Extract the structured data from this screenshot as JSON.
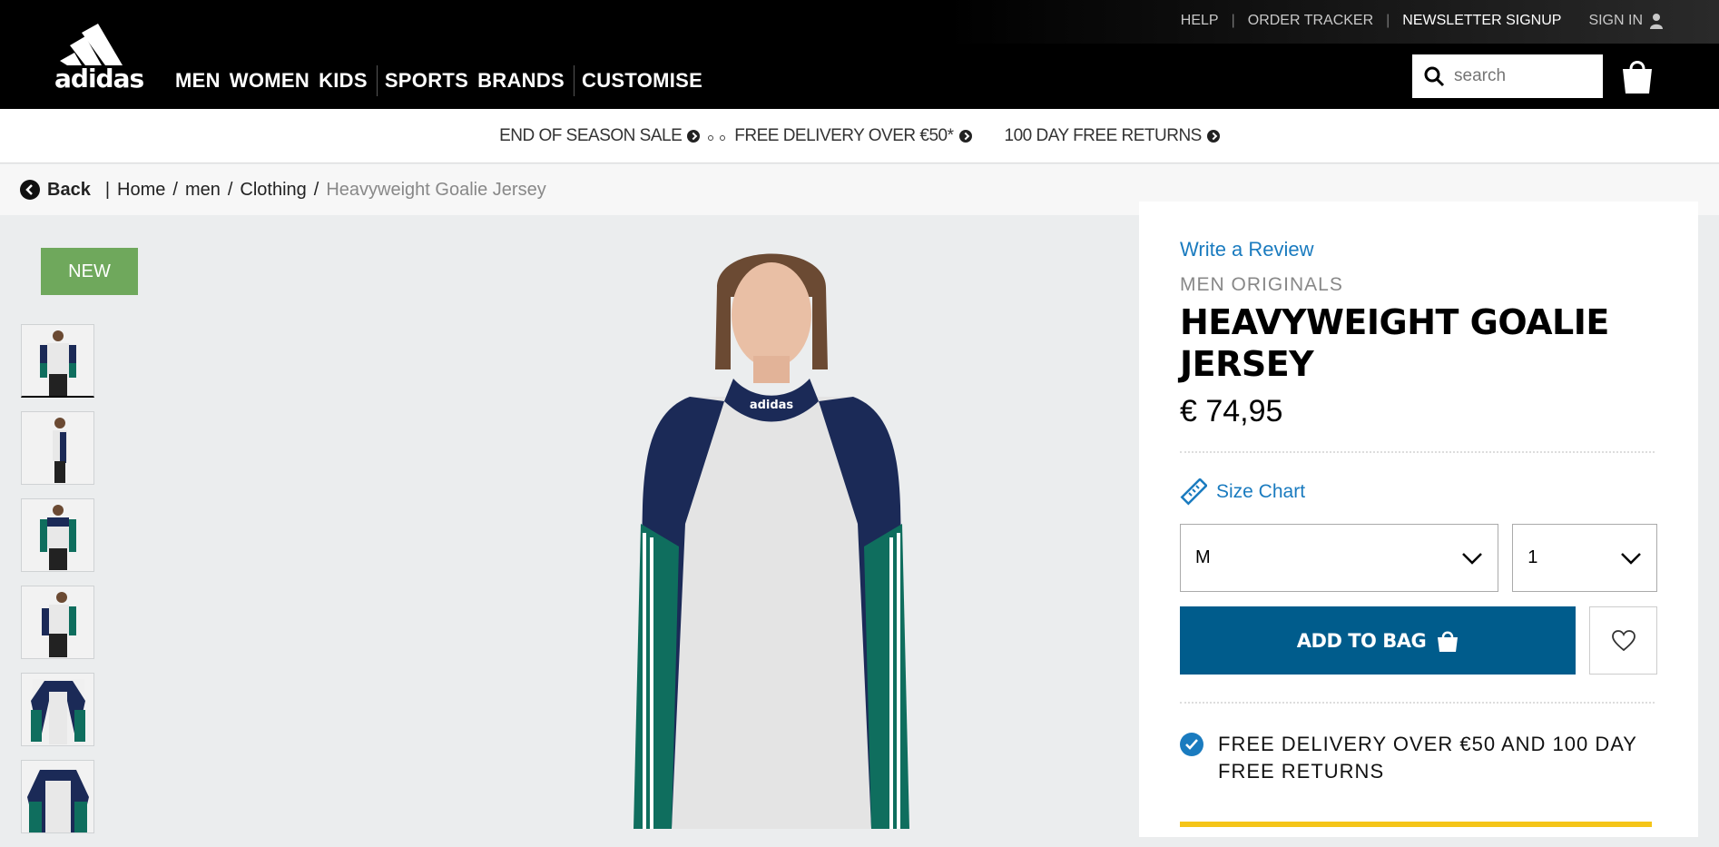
{
  "utility_nav": {
    "help": "HELP",
    "order_tracker": "ORDER TRACKER",
    "newsletter": "NEWSLETTER SIGNUP",
    "sign_in": "SIGN IN"
  },
  "brand": {
    "logo_text": "adidas"
  },
  "main_nav": {
    "men": "MEN",
    "women": "WOMEN",
    "kids": "KIDS",
    "sports": "SPORTS",
    "brands": "BRANDS",
    "customise": "CUSTOMISE"
  },
  "search": {
    "placeholder": "search"
  },
  "promos": {
    "sale": "END OF SEASON SALE",
    "delivery": "FREE DELIVERY OVER €50*",
    "returns": "100 DAY FREE RETURNS"
  },
  "breadcrumb": {
    "back": "Back",
    "home": "Home",
    "men": "men",
    "clothing": "Clothing",
    "current": "Heavyweight Goalie Jersey",
    "sep1": "|",
    "sep2": "/",
    "sep3": "/",
    "sep4": "/"
  },
  "gallery": {
    "badge": "NEW",
    "thumbnail_count": 6
  },
  "product": {
    "review_link": "Write a Review",
    "category": "MEN ORIGINALS",
    "title_line1": "HEAVYWEIGHT GOALIE",
    "title_line2": "JERSEY",
    "price": "€ 74,95",
    "size_chart": "Size Chart",
    "size_selected": "M",
    "qty_selected": "1",
    "add_to_bag": "ADD TO BAG",
    "delivery_line1": "FREE DELIVERY OVER €50 AND 100 DAY",
    "delivery_line2": "FREE RETURNS"
  },
  "colors": {
    "accent_blue": "#1a7bbf",
    "button_blue": "#005c8c",
    "badge_green": "#6fa85c",
    "header_black": "#000000"
  }
}
